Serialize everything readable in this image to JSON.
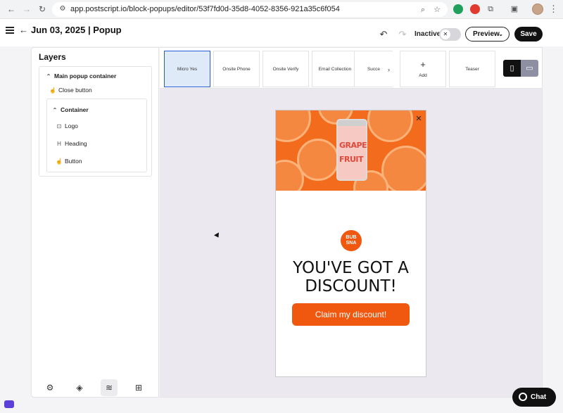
{
  "browser": {
    "url": "app.postscript.io/block-popups/editor/53f7fd0d-35d8-4052-8356-921a35c6f054"
  },
  "header": {
    "title": "Jun 03, 2025 | Popup",
    "status_label": "Inactive",
    "preview_label": "Preview",
    "save_label": "Save"
  },
  "layers": {
    "title": "Layers",
    "root": "Main popup container",
    "close": "Close button",
    "container": "Container",
    "children": [
      "Logo",
      "Heading",
      "Button"
    ]
  },
  "steps": {
    "items": [
      "Micro Yes",
      "Onsite Phone",
      "Onsite Verify",
      "Email Collection",
      "Succe"
    ],
    "add_label": "Add",
    "teaser_label": "Teaser"
  },
  "popup": {
    "can_text": [
      "GRAPE",
      "FRUIT"
    ],
    "logo_text": "BUB SNA",
    "headline": "YOU'VE GOT A DISCOUNT!",
    "cta": "Claim my discount!"
  },
  "chat": {
    "label": "Chat"
  },
  "colors": {
    "brand_orange": "#f0570f",
    "primary_dark": "#111111",
    "active_step": "#dfeaf8"
  }
}
